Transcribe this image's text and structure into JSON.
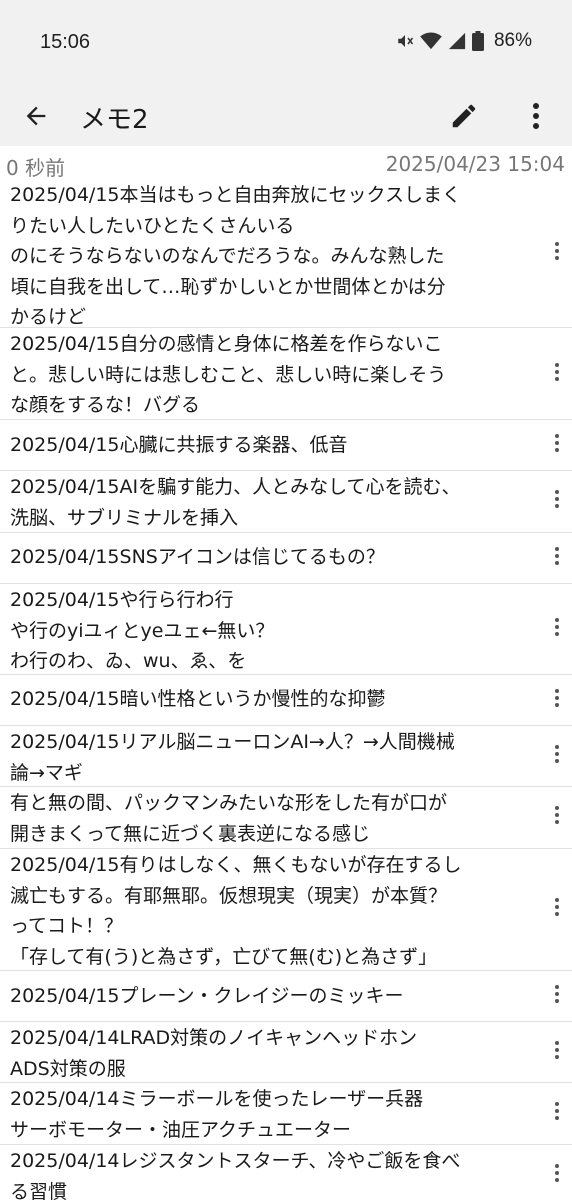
{
  "status": {
    "time": "15:06",
    "battery": "86%",
    "icons": [
      "mute-icon",
      "wifi-icon",
      "signal-icon",
      "battery-icon"
    ]
  },
  "appbar": {
    "title": "メモ2",
    "back_icon": "arrow-back-icon",
    "edit_icon": "pencil-icon",
    "menu_icon": "more-vert-icon"
  },
  "meta": {
    "elapsed": "0 秒前",
    "updated": "2025/04/23 15:04"
  },
  "items": [
    {
      "text": "2025/04/15本当はもっと自由奔放にセックスしまく\nりたい人したいひとたくさんいる\nのにそうならないのなんでだろうな。みんな熟した\n頃に自我を出して…恥ずかしいとか世間体とかは分\nかるけど"
    },
    {
      "text": "2025/04/15自分の感情と身体に格差を作らないこ\nと。悲しい時には悲しむこと、悲しい時に楽しそう\nな顔をするな！バグる"
    },
    {
      "text": "2025/04/15心臓に共振する楽器、低音"
    },
    {
      "text": "2025/04/15AIを騙す能力、人とみなして心を読む、\n洗脳、サブリミナルを挿入"
    },
    {
      "text": "2025/04/15SNSアイコンは信じてるもの？"
    },
    {
      "text": "2025/04/15や行ら行わ行\nや行のyiユィとyeユェ←無い？\nわ行のわ、ゐ、wu、ゑ、を"
    },
    {
      "text": "2025/04/15暗い性格というか慢性的な抑鬱"
    },
    {
      "text": "2025/04/15リアル脳ニューロンAI→人？→人間機械\n論→マギ"
    },
    {
      "text": "有と無の間、パックマンみたいな形をした有が口が\n開きまくって無に近づく裏表逆になる感じ"
    },
    {
      "text": "2025/04/15有りはしなく、無くもないが存在するし\n滅亡もする。有耶無耶。仮想現実（現実）が本質？\nってコト！？\n「存して有(う)と為さず，亡びて無(む)と為さず」"
    },
    {
      "text": "2025/04/15プレーン・クレイジーのミッキー"
    },
    {
      "text": "2025/04/14LRAD対策のノイキャンヘッドホン\nADS対策の服"
    },
    {
      "text": "2025/04/14ミラーボールを使ったレーザー兵器\nサーボモーター・油圧アクチュエーター"
    },
    {
      "text": "2025/04/14レジスタントスターチ、冷やご飯を食べ\nる習慣"
    }
  ]
}
